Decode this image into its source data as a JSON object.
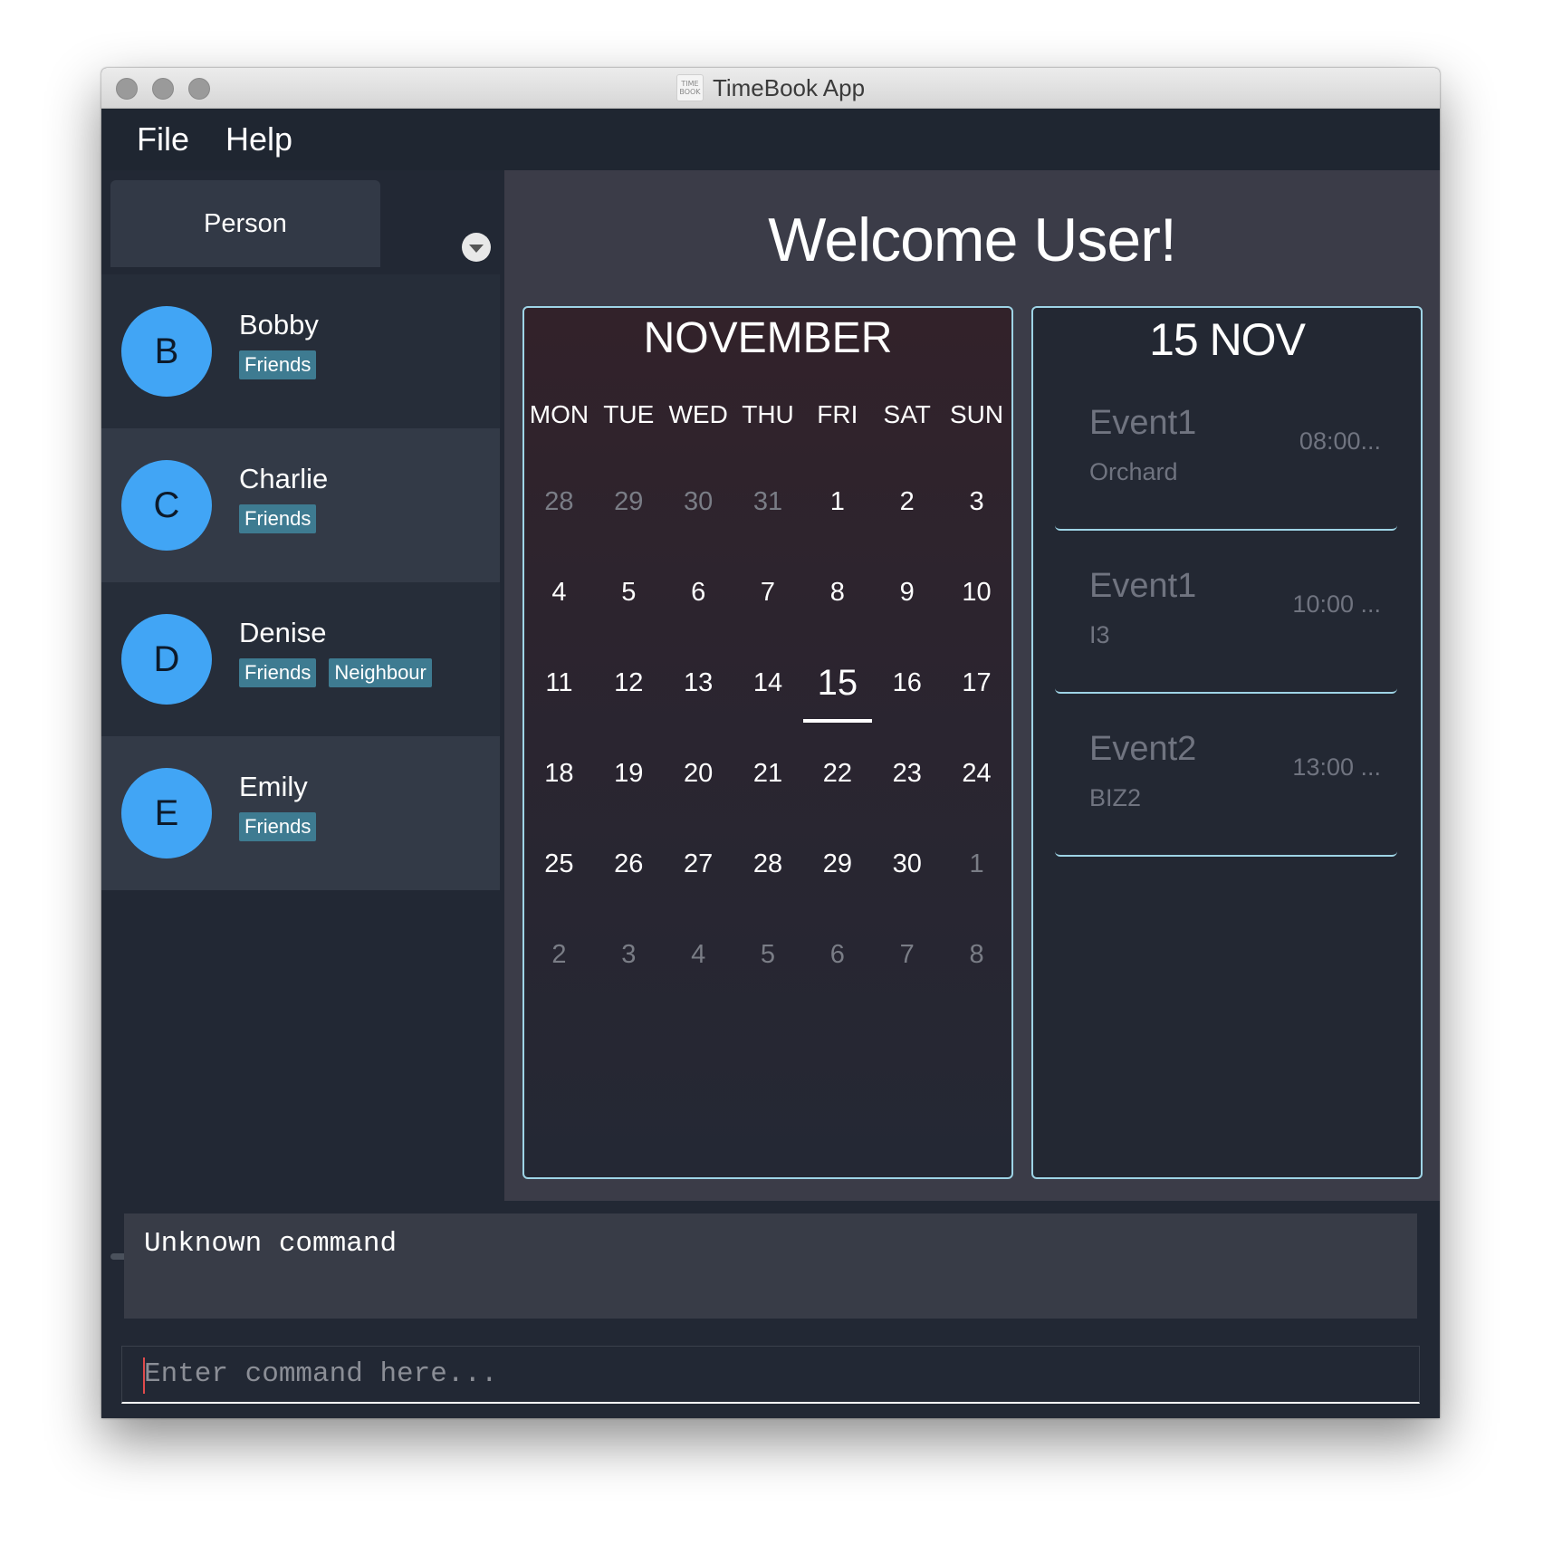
{
  "window": {
    "title": "TimeBook App",
    "icon_text": [
      "TIME",
      "BOOK"
    ]
  },
  "menu": {
    "items": [
      "File",
      "Help"
    ]
  },
  "sidebar": {
    "tab_label": "Person",
    "persons": [
      {
        "initial": "B",
        "name": "Bobby",
        "tags": [
          "Friends"
        ]
      },
      {
        "initial": "C",
        "name": "Charlie",
        "tags": [
          "Friends"
        ]
      },
      {
        "initial": "D",
        "name": "Denise",
        "tags": [
          "Friends",
          "Neighbour"
        ]
      },
      {
        "initial": "E",
        "name": "Emily",
        "tags": [
          "Friends"
        ]
      }
    ]
  },
  "main": {
    "welcome": "Welcome User!"
  },
  "calendar": {
    "month": "NOVEMBER",
    "weekdays": [
      "MON",
      "TUE",
      "WED",
      "THU",
      "FRI",
      "SAT",
      "SUN"
    ],
    "days": [
      {
        "d": "28",
        "muted": true
      },
      {
        "d": "29",
        "muted": true
      },
      {
        "d": "30",
        "muted": true
      },
      {
        "d": "31",
        "muted": true
      },
      {
        "d": "1"
      },
      {
        "d": "2"
      },
      {
        "d": "3"
      },
      {
        "d": "4"
      },
      {
        "d": "5"
      },
      {
        "d": "6"
      },
      {
        "d": "7"
      },
      {
        "d": "8"
      },
      {
        "d": "9"
      },
      {
        "d": "10"
      },
      {
        "d": "11"
      },
      {
        "d": "12"
      },
      {
        "d": "13"
      },
      {
        "d": "14"
      },
      {
        "d": "15",
        "today": true
      },
      {
        "d": "16"
      },
      {
        "d": "17"
      },
      {
        "d": "18"
      },
      {
        "d": "19"
      },
      {
        "d": "20"
      },
      {
        "d": "21"
      },
      {
        "d": "22"
      },
      {
        "d": "23"
      },
      {
        "d": "24"
      },
      {
        "d": "25"
      },
      {
        "d": "26"
      },
      {
        "d": "27"
      },
      {
        "d": "28"
      },
      {
        "d": "29"
      },
      {
        "d": "30"
      },
      {
        "d": "1",
        "muted": true
      },
      {
        "d": "2",
        "muted": true
      },
      {
        "d": "3",
        "muted": true
      },
      {
        "d": "4",
        "muted": true
      },
      {
        "d": "5",
        "muted": true
      },
      {
        "d": "6",
        "muted": true
      },
      {
        "d": "7",
        "muted": true
      },
      {
        "d": "8",
        "muted": true
      }
    ]
  },
  "day_panel": {
    "title": "15 NOV",
    "events": [
      {
        "name": "Event1",
        "location": "Orchard",
        "time": "08:00..."
      },
      {
        "name": "Event1",
        "location": "I3",
        "time": "10:00 ..."
      },
      {
        "name": "Event2",
        "location": "BIZ2",
        "time": "13:00 ..."
      }
    ]
  },
  "result": {
    "text": "Unknown command"
  },
  "command": {
    "value": "",
    "placeholder": "Enter command here..."
  },
  "colors": {
    "avatar": "#41a5f5",
    "tag": "#3e7b91",
    "accent_border": "#9ed4e6",
    "background": "#222834"
  }
}
